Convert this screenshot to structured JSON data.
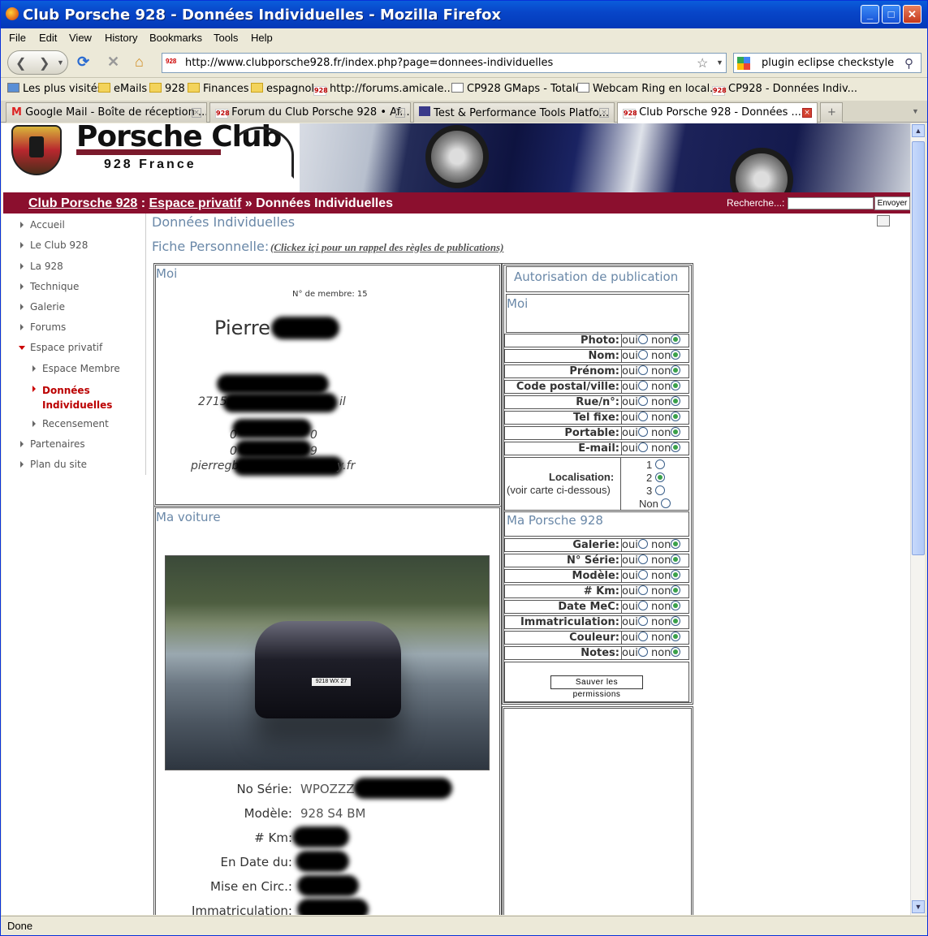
{
  "window": {
    "title": "Club Porsche 928 - Données Individuelles - Mozilla Firefox",
    "min": "_",
    "max": "□",
    "close": "✕"
  },
  "menu": [
    "File",
    "Edit",
    "View",
    "History",
    "Bookmarks",
    "Tools",
    "Help"
  ],
  "nav": {
    "url": "http://www.clubporsche928.fr/index.php?page=donnees-individuelles",
    "search": "plugin eclipse checkstyle"
  },
  "bookmarks": [
    "Les plus visités",
    "eMails",
    "928",
    "Finances",
    "espagnol",
    "http://forums.amicale...",
    "CP928 GMaps - Totale",
    "Webcam Ring en local...",
    "CP928 - Données Indiv..."
  ],
  "tabs": [
    "Google Mail - Boîte de réception ...",
    "Forum du Club Porsche 928 • Af...",
    "Test & Performance Tools Platfo...",
    "Club Porsche 928 - Données ..."
  ],
  "status": "Done",
  "site": {
    "logo_title": "Porsche Club",
    "logo_sub": "928 France",
    "crumb1": "Club Porsche 928",
    "crumb_sep1": " : ",
    "crumb2": "Espace privatif",
    "crumb_rest": " » Données Individuelles",
    "search_label": "Recherche...:",
    "search_button": "Envoyer"
  },
  "sidebar": [
    "Accueil",
    "Le Club 928",
    "La 928",
    "Technique",
    "Galerie",
    "Forums",
    "Espace privatif",
    "Espace Membre",
    "Données Individuelles",
    "Recensement",
    "Partenaires",
    "Plan du site"
  ],
  "main": {
    "title": "Données Individuelles",
    "fiche": "Fiche Personnelle:",
    "rappel": "(Clickez içi pour un rappel des règles de publications)",
    "moi_heading": "Moi",
    "member_no": "N° de membre: 15",
    "name": "Pierre",
    "city_part": "2715",
    "city_end": "il",
    "phone1_end": "0",
    "phone1_start": "0",
    "phone2_start": "0",
    "phone2_end": "9",
    "email_start": "pierregb",
    "email_end": "y.fr",
    "voiture_heading": "Ma voiture",
    "plate": "9218 WX 27",
    "car": [
      {
        "label": "No Série:",
        "value": "WPOZZZ"
      },
      {
        "label": "Modèle:",
        "value": "928 S4 BM"
      },
      {
        "label": "# Km:",
        "value": ""
      },
      {
        "label": "En Date du:",
        "value": ""
      },
      {
        "label": "Mise en Circ.:",
        "value": ""
      },
      {
        "label": "Immatriculation:",
        "value": ""
      }
    ]
  },
  "perm": {
    "title": "Autorisation de publication",
    "moi": "Moi",
    "oui": "oui",
    "non": "non",
    "rows_moi": [
      "Photo:",
      "Nom:",
      "Prénom:",
      "Code postal/ville:",
      "Rue/n°:",
      "Tel fixe:",
      "Portable:",
      "E-mail:"
    ],
    "loc_label": "Localisation:",
    "loc_note": "(voir carte ci-dessous)",
    "loc_opts": [
      "1",
      "2",
      "3",
      "Non"
    ],
    "porsche": "Ma Porsche 928",
    "rows_car": [
      "Galerie:",
      "N° Série:",
      "Modèle:",
      "# Km:",
      "Date MeC:",
      "Immatriculation:",
      "Couleur:",
      "Notes:"
    ],
    "save": "Sauver les permissions"
  }
}
